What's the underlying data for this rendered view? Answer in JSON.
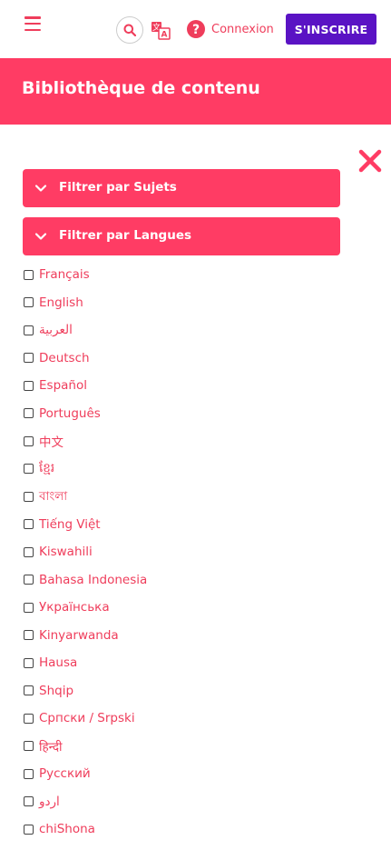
{
  "header": {
    "login_label": "Connexion",
    "signup_label": "S'INSCRIRE",
    "icons": [
      "hamburger-menu-icon",
      "search-icon",
      "translate-icon",
      "help-icon"
    ],
    "accent_color": "#ef3d5b",
    "signup_color": "#5a13c4"
  },
  "banner": {
    "title": "Bibliothèque de contenu",
    "color": "#ff3c64"
  },
  "filters": {
    "subjects_label": "Filtrer par Sujets",
    "languages_label": "Filtrer par Langues"
  },
  "languages": [
    "Français",
    "English",
    "العربية",
    "Deutsch",
    "Español",
    "Português",
    "中文",
    "ខ្មែរ",
    "বাংলা",
    "Tiếng Việt",
    "Kiswahili",
    "Bahasa Indonesia",
    "Українська",
    "Kinyarwanda",
    "Hausa",
    "Shqip",
    "Српски / Srpski",
    "हिन्दी",
    "Русский",
    "اردو",
    "chiShona"
  ]
}
